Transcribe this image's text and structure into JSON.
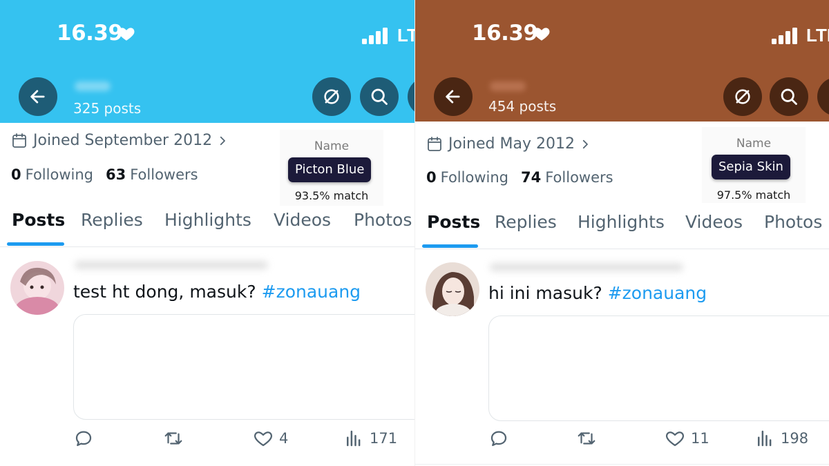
{
  "panels": [
    {
      "header_color": "#35c2f0",
      "button_color": "#1e5c76",
      "status": {
        "time": "16.39",
        "network": "LTE"
      },
      "posts_count": "325 posts",
      "joined": "Joined September 2012",
      "following_count": "0",
      "following_label": "Following",
      "followers_count": "63",
      "followers_label": "Followers",
      "color_name_label": "Name",
      "color_name": "Picton Blue",
      "color_match": "93.5% match",
      "tabs": [
        "Posts",
        "Replies",
        "Highlights",
        "Videos",
        "Photos"
      ],
      "tweet": {
        "text": "test ht dong, masuk?",
        "hashtag": "#zonauang",
        "likes": "4",
        "views": "171"
      }
    },
    {
      "header_color": "#9b5530",
      "button_color": "#4a2613",
      "status": {
        "time": "16.39",
        "network": "LTE"
      },
      "posts_count": "454 posts",
      "joined": "Joined May 2012",
      "following_count": "0",
      "following_label": "Following",
      "followers_count": "74",
      "followers_label": "Followers",
      "color_name_label": "Name",
      "color_name": "Sepia Skin",
      "color_match": "97.5% match",
      "tabs": [
        "Posts",
        "Replies",
        "Highlights",
        "Videos",
        "Photos"
      ],
      "tweet": {
        "text": "hi ini masuk?",
        "hashtag": "#zonauang",
        "likes": "11",
        "views": "198"
      }
    }
  ],
  "icons": [
    "heart-icon",
    "signal-icon",
    "back-arrow-icon",
    "no-edit-icon",
    "search-icon",
    "calendar-icon",
    "chevron-right-icon",
    "reply-icon",
    "retweet-icon",
    "like-icon",
    "views-icon"
  ]
}
